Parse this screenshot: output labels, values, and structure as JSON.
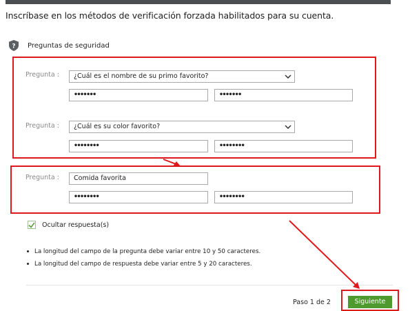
{
  "heading": "Inscríbase en los métodos de verificación forzada habilitados para su cuenta.",
  "section": {
    "title": "Preguntas de seguridad",
    "icon": "shield-question-icon"
  },
  "questions": [
    {
      "label": "Pregunta :",
      "value": "¿Cuál es el nombre de su primo favorito?",
      "answer": "•••••••",
      "confirm": "•••••••"
    },
    {
      "label": "Pregunta :",
      "value": "¿Cuál es su color favorito?",
      "answer": "••••••••",
      "confirm": "••••••••"
    },
    {
      "label": "Pregunta :",
      "value": "Comida favorita",
      "answer": "••••••••",
      "confirm": "••••••••"
    }
  ],
  "hide_answers": {
    "label": "Ocultar respuesta(s)",
    "checked": true
  },
  "rules": [
    "La longitud del campo de la pregunta debe variar entre 10 y 50 caracteres.",
    "La longitud del campo de respuesta debe variar entre 5 y 20 caracteres."
  ],
  "footer": {
    "step": "Paso 1 de 2",
    "next_label": "Siguiente"
  },
  "colors": {
    "annotation_red": "#e0171b",
    "primary_green": "#4f9a2f",
    "check_green": "#5aa03a"
  }
}
